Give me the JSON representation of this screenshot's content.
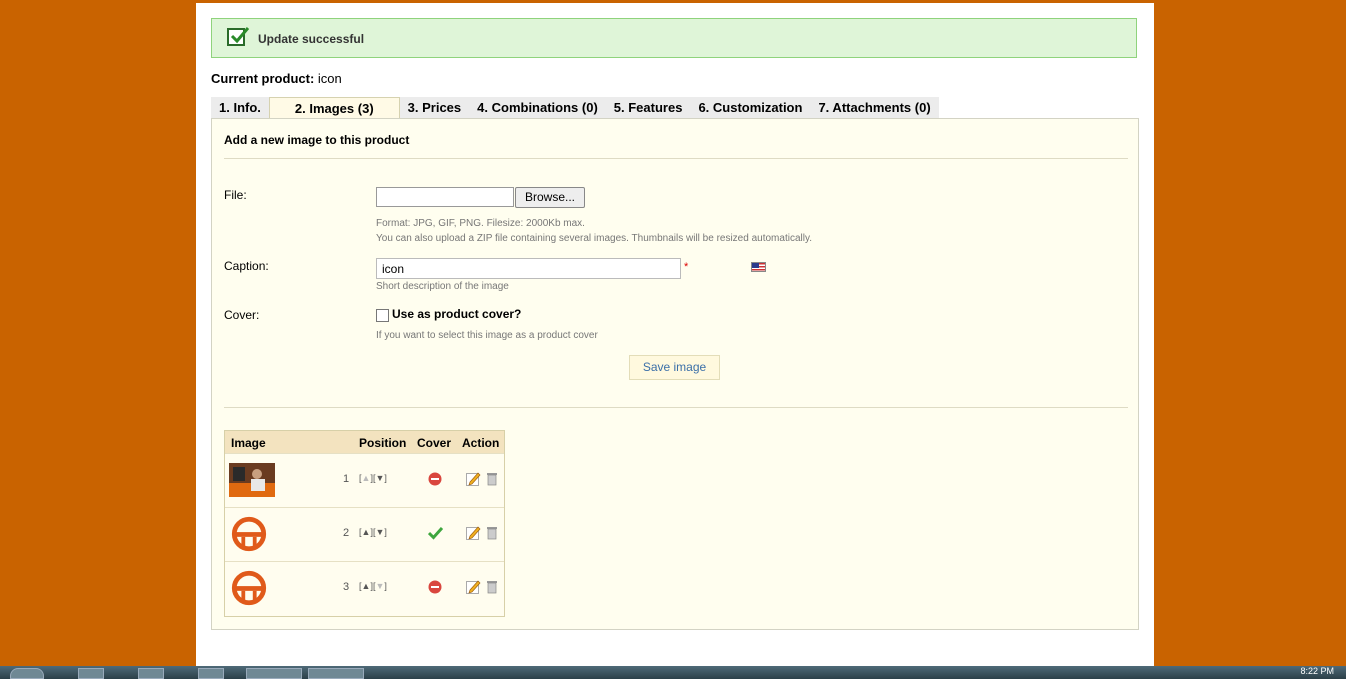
{
  "alert": {
    "message": "Update successful"
  },
  "product": {
    "label": "Current product:",
    "name": "icon"
  },
  "tabs": [
    {
      "label": "1. Info."
    },
    {
      "label": "2. Images (3)"
    },
    {
      "label": "3. Prices"
    },
    {
      "label": "4. Combinations (0)"
    },
    {
      "label": "5. Features"
    },
    {
      "label": "6. Customization"
    },
    {
      "label": "7. Attachments (0)"
    }
  ],
  "form": {
    "title": "Add a new image to this product",
    "file_label": "File:",
    "browse_label": "Browse...",
    "file_hint1": "Format: JPG, GIF, PNG. Filesize: 2000Kb max.",
    "file_hint2": "You can also upload a ZIP file containing several images. Thumbnails will be resized automatically.",
    "caption_label": "Caption:",
    "caption_value": "icon",
    "required_mark": "*",
    "caption_hint": "Short description of the image",
    "cover_label": "Cover:",
    "cover_checkbox_label": "Use as product cover?",
    "cover_hint": "If you want to select this image as a product cover",
    "save_label": "Save image"
  },
  "images_table": {
    "headers": {
      "image": "Image",
      "position": "Position",
      "cover": "Cover",
      "action": "Action"
    },
    "rows": [
      {
        "position": "1",
        "cover": false,
        "thumb": "photo-thumbnail"
      },
      {
        "position": "2",
        "cover": true,
        "thumb": "logo-thumbnail"
      },
      {
        "position": "3",
        "cover": false,
        "thumb": "logo-thumbnail"
      }
    ]
  },
  "taskbar": {
    "clock": "8:22 PM"
  },
  "colors": {
    "background": "#c96300",
    "accent": "#e05a1a",
    "link": "#3b6fa8"
  }
}
